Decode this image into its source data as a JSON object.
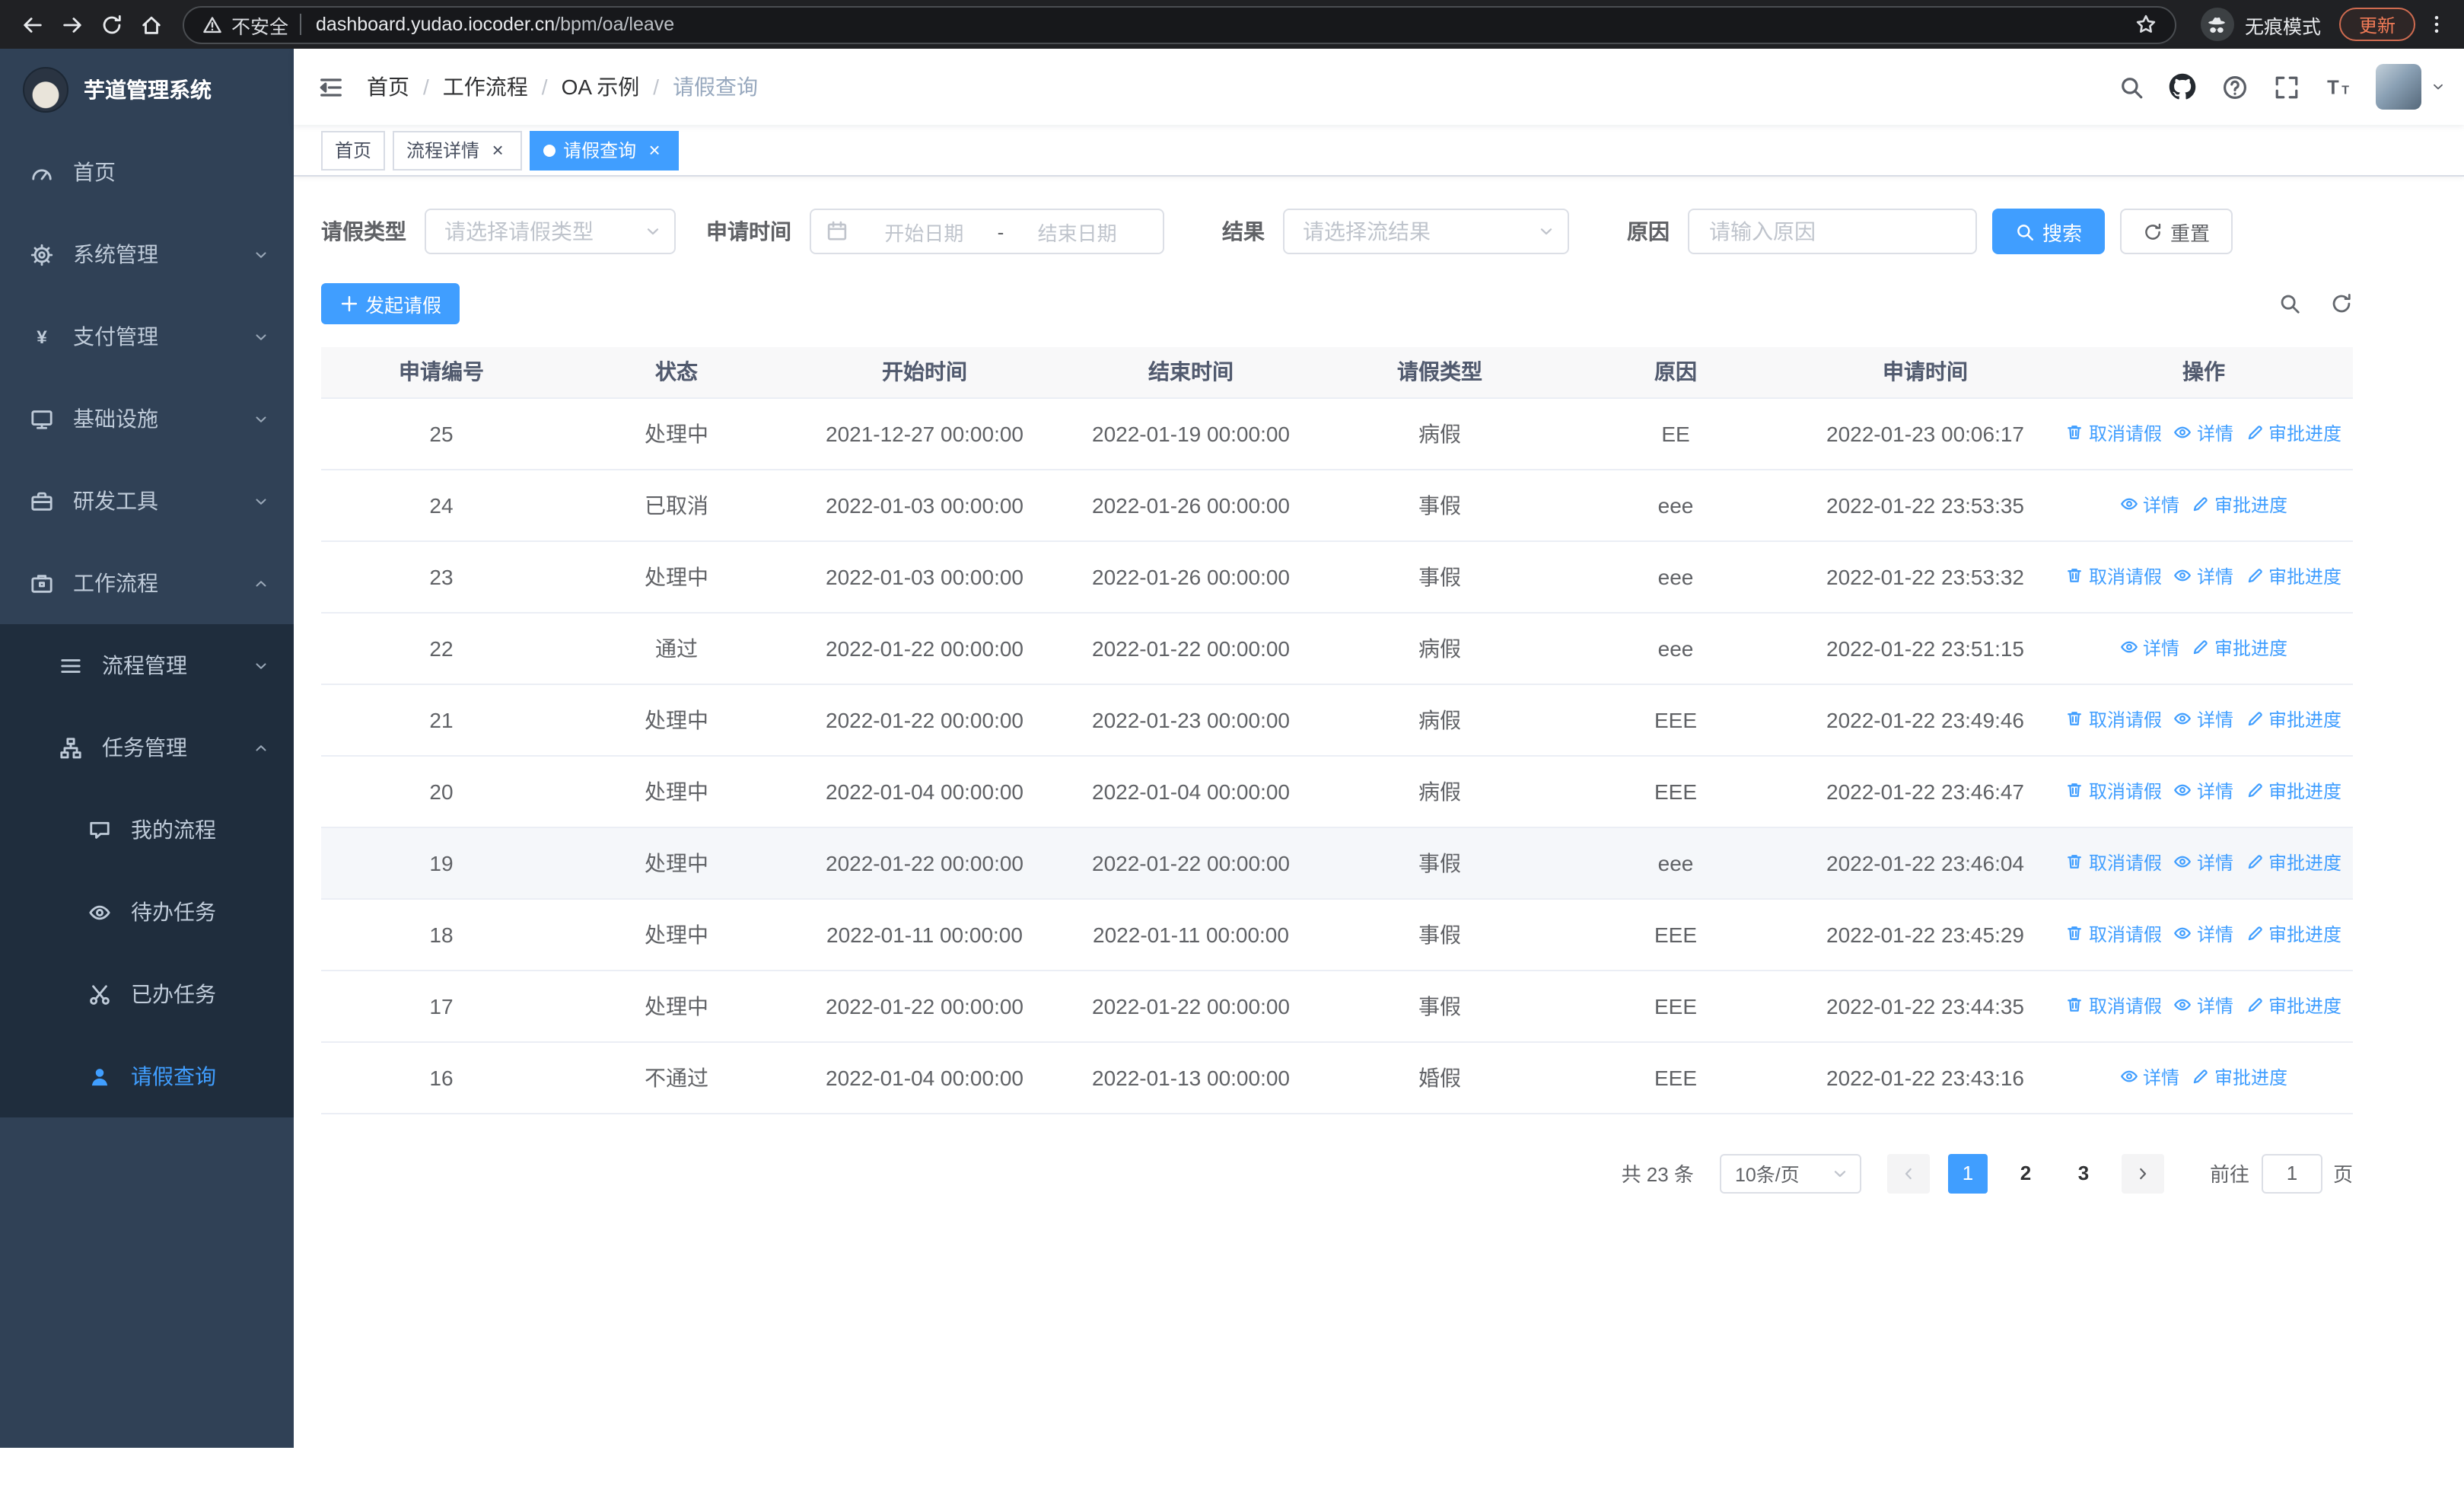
{
  "browser": {
    "security_chip": "不安全",
    "url_domain": "dashboard.yudao.iocoder.cn",
    "url_path": "/bpm/oa/leave",
    "incognito_label": "无痕模式",
    "update_button": "更新"
  },
  "sidebar": {
    "logo_title": "芋道管理系统",
    "items": [
      {
        "label": "首页",
        "icon": "dashboard-icon",
        "level": 1
      },
      {
        "label": "系统管理",
        "icon": "gear-icon",
        "level": 1,
        "chevron": "down"
      },
      {
        "label": "支付管理",
        "icon": "yen-icon",
        "level": 1,
        "chevron": "down"
      },
      {
        "label": "基础设施",
        "icon": "monitor-icon",
        "level": 1,
        "chevron": "down"
      },
      {
        "label": "研发工具",
        "icon": "briefcase-icon",
        "level": 1,
        "chevron": "down"
      },
      {
        "label": "工作流程",
        "icon": "workflow-icon",
        "level": 1,
        "chevron": "up"
      },
      {
        "label": "流程管理",
        "icon": "list-icon",
        "level": 2,
        "chevron": "down"
      },
      {
        "label": "任务管理",
        "icon": "org-icon",
        "level": 2,
        "chevron": "up"
      },
      {
        "label": "我的流程",
        "icon": "message-icon",
        "level": 3
      },
      {
        "label": "待办任务",
        "icon": "eye-icon",
        "level": 3
      },
      {
        "label": "已办任务",
        "icon": "scissors-icon",
        "level": 3
      },
      {
        "label": "请假查询",
        "icon": "user-icon",
        "level": 3,
        "active": true
      }
    ]
  },
  "navbar": {
    "breadcrumb": [
      "首页",
      "工作流程",
      "OA 示例",
      "请假查询"
    ]
  },
  "tabs": [
    {
      "label": "首页"
    },
    {
      "label": "流程详情",
      "closable": true
    },
    {
      "label": "请假查询",
      "closable": true,
      "active": true
    }
  ],
  "filters": {
    "leave_type_label": "请假类型",
    "leave_type_placeholder": "请选择请假类型",
    "apply_time_label": "申请时间",
    "start_date_placeholder": "开始日期",
    "range_separator": "-",
    "end_date_placeholder": "结束日期",
    "result_label": "结果",
    "result_placeholder": "请选择流结果",
    "reason_label": "原因",
    "reason_placeholder": "请输入原因",
    "search_button": "搜索",
    "reset_button": "重置"
  },
  "toolbar": {
    "create_button": "发起请假"
  },
  "table": {
    "columns": [
      "申请编号",
      "状态",
      "开始时间",
      "结束时间",
      "请假类型",
      "原因",
      "申请时间",
      "操作"
    ],
    "action_labels": {
      "cancel": "取消请假",
      "detail": "详情",
      "progress": "审批进度"
    },
    "rows": [
      {
        "id": "25",
        "status": "处理中",
        "start_time": "2021-12-27 00:00:00",
        "end_time": "2022-01-19 00:00:00",
        "leave_type": "病假",
        "reason": "EE",
        "apply_time": "2022-01-23 00:06:17",
        "can_cancel": true
      },
      {
        "id": "24",
        "status": "已取消",
        "start_time": "2022-01-03 00:00:00",
        "end_time": "2022-01-26 00:00:00",
        "leave_type": "事假",
        "reason": "eee",
        "apply_time": "2022-01-22 23:53:35",
        "can_cancel": false
      },
      {
        "id": "23",
        "status": "处理中",
        "start_time": "2022-01-03 00:00:00",
        "end_time": "2022-01-26 00:00:00",
        "leave_type": "事假",
        "reason": "eee",
        "apply_time": "2022-01-22 23:53:32",
        "can_cancel": true
      },
      {
        "id": "22",
        "status": "通过",
        "start_time": "2022-01-22 00:00:00",
        "end_time": "2022-01-22 00:00:00",
        "leave_type": "病假",
        "reason": "eee",
        "apply_time": "2022-01-22 23:51:15",
        "can_cancel": false
      },
      {
        "id": "21",
        "status": "处理中",
        "start_time": "2022-01-22 00:00:00",
        "end_time": "2022-01-23 00:00:00",
        "leave_type": "病假",
        "reason": "EEE",
        "apply_time": "2022-01-22 23:49:46",
        "can_cancel": true
      },
      {
        "id": "20",
        "status": "处理中",
        "start_time": "2022-01-04 00:00:00",
        "end_time": "2022-01-04 00:00:00",
        "leave_type": "病假",
        "reason": "EEE",
        "apply_time": "2022-01-22 23:46:47",
        "can_cancel": true
      },
      {
        "id": "19",
        "status": "处理中",
        "start_time": "2022-01-22 00:00:00",
        "end_time": "2022-01-22 00:00:00",
        "leave_type": "事假",
        "reason": "eee",
        "apply_time": "2022-01-22 23:46:04",
        "can_cancel": true,
        "highlighted": true
      },
      {
        "id": "18",
        "status": "处理中",
        "start_time": "2022-01-11 00:00:00",
        "end_time": "2022-01-11 00:00:00",
        "leave_type": "事假",
        "reason": "EEE",
        "apply_time": "2022-01-22 23:45:29",
        "can_cancel": true
      },
      {
        "id": "17",
        "status": "处理中",
        "start_time": "2022-01-22 00:00:00",
        "end_time": "2022-01-22 00:00:00",
        "leave_type": "事假",
        "reason": "EEE",
        "apply_time": "2022-01-22 23:44:35",
        "can_cancel": true
      },
      {
        "id": "16",
        "status": "不通过",
        "start_time": "2022-01-04 00:00:00",
        "end_time": "2022-01-13 00:00:00",
        "leave_type": "婚假",
        "reason": "EEE",
        "apply_time": "2022-01-22 23:43:16",
        "can_cancel": false
      }
    ]
  },
  "pagination": {
    "total_text": "共 23 条",
    "page_size_text": "10条/页",
    "pages": [
      "1",
      "2",
      "3"
    ],
    "active_page": "1",
    "goto_label": "前往",
    "goto_value": "1",
    "goto_suffix": "页"
  },
  "colors": {
    "primary": "#409eff",
    "sidebar_bg": "#304156",
    "submenu_bg": "#1f2d3d"
  }
}
